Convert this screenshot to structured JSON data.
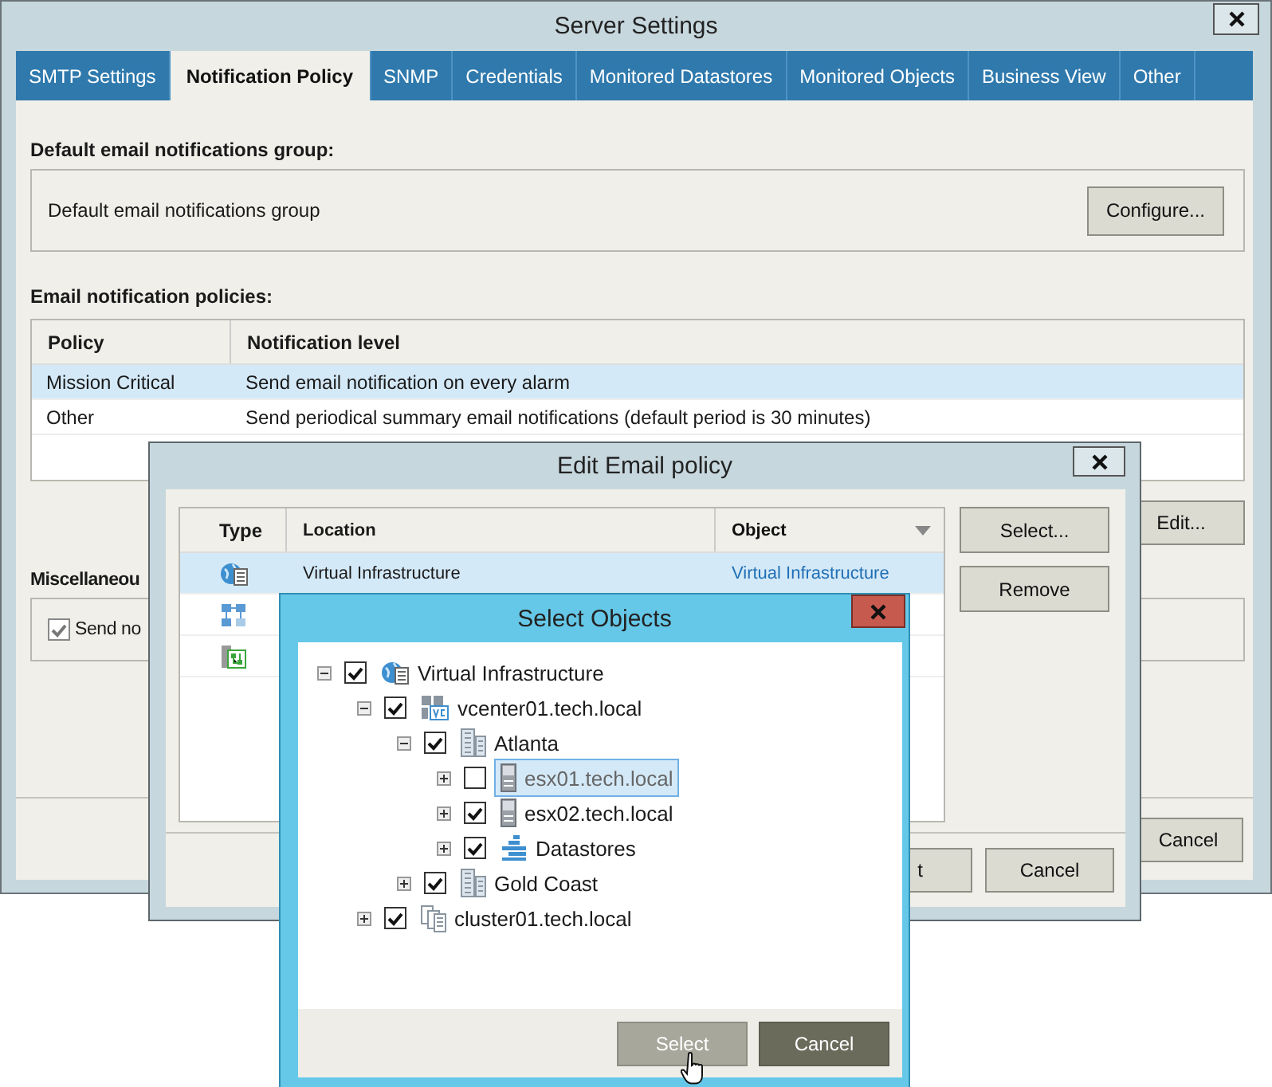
{
  "server_settings": {
    "title": "Server Settings",
    "tabs": [
      {
        "label": "SMTP Settings",
        "selected": false
      },
      {
        "label": "Notification Policy",
        "selected": true
      },
      {
        "label": "SNMP",
        "selected": false
      },
      {
        "label": "Credentials",
        "selected": false
      },
      {
        "label": "Monitored Datastores",
        "selected": false
      },
      {
        "label": "Monitored Objects",
        "selected": false
      },
      {
        "label": "Business View",
        "selected": false
      },
      {
        "label": "Other",
        "selected": false
      }
    ],
    "default_group": {
      "heading": "Default email notifications group:",
      "label": "Default email notifications group",
      "button": "Configure..."
    },
    "policies": {
      "heading": "Email notification policies:",
      "columns": [
        "Policy",
        "Notification level"
      ],
      "rows": [
        {
          "policy": "Mission Critical",
          "notification": "Send email notification on every alarm",
          "selected": true
        },
        {
          "policy": "Other",
          "notification": "Send periodical summary email notifications (default period is 30 minutes)",
          "selected": false
        }
      ],
      "edit_button": "Edit..."
    },
    "miscellaneous": {
      "heading": "Miscellaneou",
      "checkbox": {
        "label": "Send no",
        "checked": true
      }
    },
    "footer_buttons": [
      "Cancel"
    ]
  },
  "edit_email_policy": {
    "title": "Edit Email policy",
    "columns": [
      "Type",
      "Location",
      "Object"
    ],
    "rows": [
      {
        "kind": "infrastructure",
        "location": "Virtual Infrastructure",
        "object": "Virtual Infrastructure",
        "selected": true
      },
      {
        "kind": "group",
        "selected": false
      },
      {
        "kind": "hostgroup",
        "selected": false
      }
    ],
    "buttons": [
      "Select...",
      "Remove"
    ],
    "footer_buttons": [
      "t",
      "Cancel"
    ]
  },
  "select_objects": {
    "title": "Select Objects",
    "tree": [
      {
        "label": "Virtual Infrastructure",
        "kind": "infrastructure",
        "checked": true,
        "expanded": true,
        "selected": false,
        "children": [
          {
            "label": "vcenter01.tech.local",
            "kind": "vcenter",
            "checked": true,
            "expanded": true,
            "selected": false,
            "children": [
              {
                "label": "Atlanta",
                "kind": "datacenter",
                "checked": true,
                "expanded": true,
                "selected": false,
                "children": [
                  {
                    "label": "esx01.tech.local",
                    "kind": "host",
                    "checked": false,
                    "expanded": false,
                    "selected": true
                  },
                  {
                    "label": "esx02.tech.local",
                    "kind": "host",
                    "checked": true,
                    "expanded": false,
                    "selected": false
                  },
                  {
                    "label": "Datastores",
                    "kind": "datastores",
                    "checked": true,
                    "expanded": false,
                    "selected": false
                  }
                ]
              },
              {
                "label": "Gold Coast",
                "kind": "datacenter",
                "checked": true,
                "expanded": false,
                "selected": false
              }
            ]
          },
          {
            "label": "cluster01.tech.local",
            "kind": "cluster",
            "checked": true,
            "expanded": false,
            "selected": false
          }
        ]
      }
    ],
    "buttons": [
      {
        "label": "Select",
        "kind": "hover"
      },
      {
        "label": "Cancel",
        "kind": "dark"
      }
    ]
  }
}
